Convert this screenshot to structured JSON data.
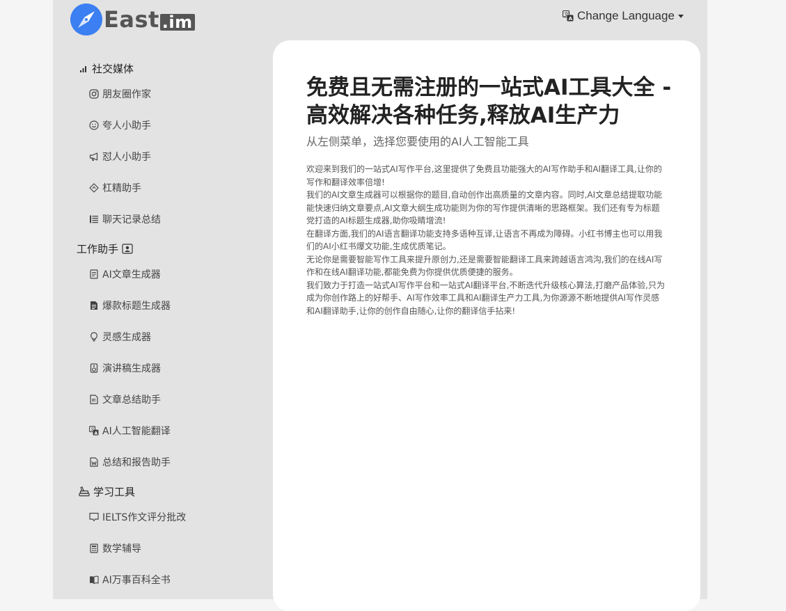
{
  "header": {
    "logo": {
      "text": "East",
      "tld": ".im"
    },
    "language_button": "Change Language"
  },
  "sidebar": {
    "sections": [
      {
        "title": "社交媒体",
        "icon": "bar-chart-icon",
        "items": [
          {
            "label": "朋友圈作家",
            "icon": "instagram-icon"
          },
          {
            "label": "夸人小助手",
            "icon": "smile-icon"
          },
          {
            "label": "怼人小助手",
            "icon": "megaphone-icon"
          },
          {
            "label": "杠精助手",
            "icon": "diamond-icon"
          },
          {
            "label": "聊天记录总结",
            "icon": "list-icon"
          }
        ]
      },
      {
        "title": "工作助手",
        "icon": "person-badge-icon",
        "items": [
          {
            "label": "AI文章生成器",
            "icon": "document-icon"
          },
          {
            "label": "爆款标题生成器",
            "icon": "file-text-icon"
          },
          {
            "label": "灵感生成器",
            "icon": "lightbulb-icon"
          },
          {
            "label": "演讲稿生成器",
            "icon": "speaker-icon"
          },
          {
            "label": "文章总结助手",
            "icon": "file-ruled-icon"
          },
          {
            "label": "AI人工智能翻译",
            "icon": "translate-icon"
          },
          {
            "label": "总结和报告助手",
            "icon": "file-word-icon"
          }
        ]
      },
      {
        "title": "学习工具",
        "icon": "books-icon",
        "items": [
          {
            "label": "IELTS作文评分批改",
            "icon": "chat-square-icon"
          },
          {
            "label": "数学辅导",
            "icon": "calculator-icon"
          },
          {
            "label": "AI万事百科全书",
            "icon": "book-icon"
          }
        ]
      }
    ]
  },
  "main": {
    "title": "免费且无需注册的一站式AI工具大全 - 高效解决各种任务,释放AI生产力",
    "subtitle": "从左侧菜单，选择您要使用的AI人工智能工具",
    "paragraphs": [
      "欢迎来到我们的一站式AI写作平台,这里提供了免费且功能强大的AI写作助手和AI翻译工具,让你的写作和翻译效率倍增!",
      "我们的AI文章生成器可以根据你的题目,自动创作出高质量的文章内容。同时,AI文章总结提取功能能快速归纳文章要点,AI文章大纲生成功能则为你的写作提供清晰的思路框架。我们还有专为标题党打造的AI标题生成器,助你吸睛增流!",
      "在翻译方面,我们的AI语言翻译功能支持多语种互译,让语言不再成为障碍。小红书博主也可以用我们的AI小红书爆文功能,生成优质笔记。",
      "无论你是需要智能写作工具来提升原创力,还是需要智能翻译工具来跨越语言鸿沟,我们的在线AI写作和在线AI翻译功能,都能免费为你提供优质便捷的服务。",
      "我们致力于打造一站式AI写作平台和一站式AI翻译平台,不断迭代升级核心算法,打磨产品体验,只为成为你创作路上的好帮手、AI写作效率工具和AI翻译生产力工具,为你源源不断地提供AI写作灵感和AI翻译助手,让你的创作自由随心,让你的翻译信手拈来!"
    ]
  },
  "colors": {
    "frame_bg": "#e3e3e3",
    "page_bg": "#f5f5f5",
    "content_bg": "#ffffff",
    "logo_blue": "#3b7ff2"
  }
}
